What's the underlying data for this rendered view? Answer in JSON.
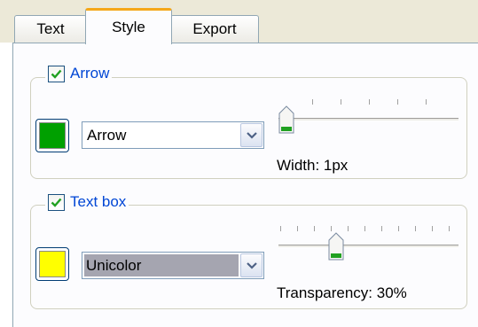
{
  "tabs": [
    {
      "label": "Text",
      "selected": false
    },
    {
      "label": "Style",
      "selected": true
    },
    {
      "label": "Export",
      "selected": false
    }
  ],
  "arrow_group": {
    "label": "Arrow",
    "checked": true,
    "color": "#00a000",
    "style_value": "Arrow",
    "width_readout": "Width: 1px",
    "width_value_fraction": 0.0
  },
  "textbox_group": {
    "label": "Text box",
    "checked": true,
    "color": "#ffff00",
    "style_value": "Unicolor",
    "transparency_readout": "Transparency: 30%",
    "transparency_percent": 30
  },
  "colors": {
    "tab_accent": "#f5a718",
    "group_label": "#0046d5",
    "thumb_accent": "#21a121"
  },
  "icons": {
    "checkbox": "checkmark-icon",
    "dropdown": "chevron-down-icon",
    "slider_thumb": "slider-thumb-icon"
  }
}
